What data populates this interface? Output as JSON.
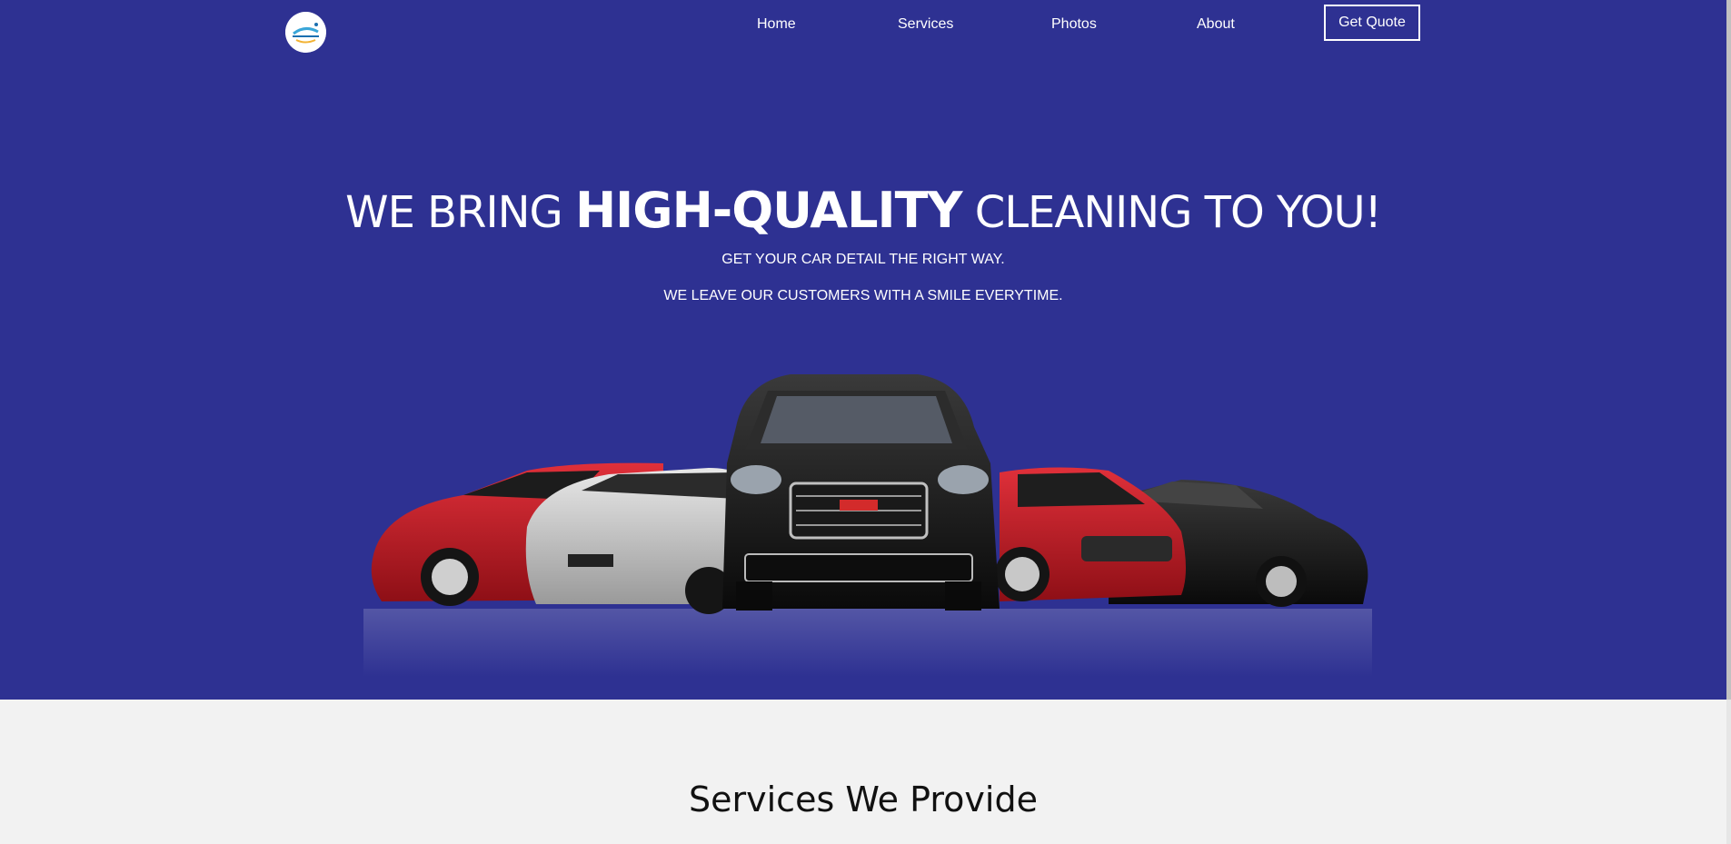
{
  "brand": {
    "logo_icon": "company-logo-badge"
  },
  "nav": {
    "items": [
      {
        "label": "Home"
      },
      {
        "label": "Services"
      },
      {
        "label": "Photos"
      },
      {
        "label": "About"
      }
    ],
    "cta_label": "Get Quote"
  },
  "hero": {
    "headline_prefix": "WE BRING",
    "headline_emphasis": "HIGH-QUALITY",
    "headline_suffix": "CLEANING TO YOU!",
    "subline_1": "GET YOUR CAR DETAIL THE RIGHT WAY.",
    "subline_2": "WE LEAVE OUR CUSTOMERS WITH A SMILE EVERYTIME.",
    "image_icon": "car-lineup-image"
  },
  "services": {
    "title": "Services We Provide"
  },
  "colors": {
    "hero_background": "#2e3192",
    "page_background": "#f2f2f2",
    "text_light": "#ffffff",
    "text_dark": "#111111"
  }
}
